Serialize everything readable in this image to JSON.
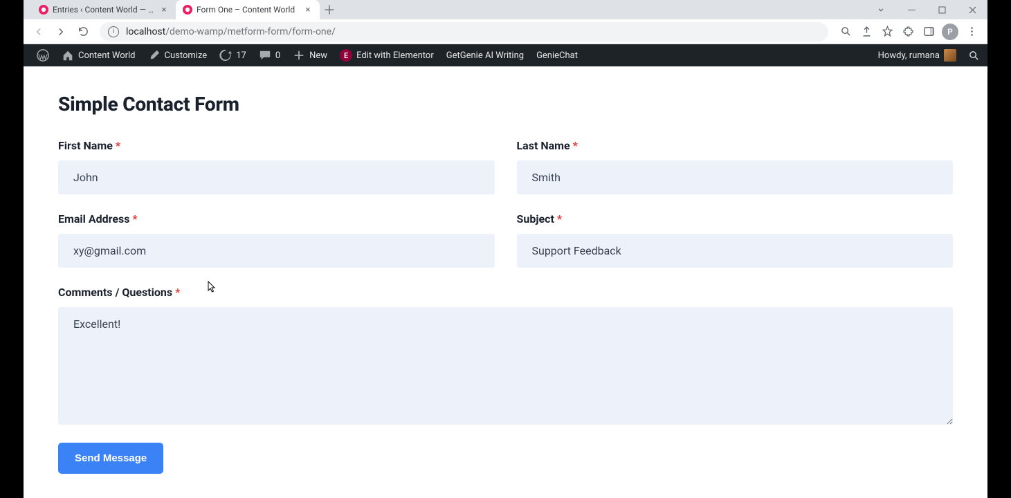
{
  "browser": {
    "tabs": [
      {
        "title": "Entries ‹ Content World — WordPress",
        "active": false
      },
      {
        "title": "Form One – Content World",
        "active": true
      }
    ],
    "url_host": "localhost",
    "url_path": "/demo-wamp/metform-form/form-one/",
    "profile_initial": "P"
  },
  "wp_bar": {
    "site_name": "Content World",
    "customize": "Customize",
    "updates_count": "17",
    "comments_count": "0",
    "new_label": "New",
    "edit_elementor": "Edit with Elementor",
    "getgenie": "GetGenie AI Writing",
    "geniechat": "GenieChat",
    "howdy": "Howdy, rumana"
  },
  "form": {
    "title": "Simple Contact Form",
    "fields": {
      "first_name": {
        "label": "First Name",
        "value": "John"
      },
      "last_name": {
        "label": "Last Name",
        "value": "Smith"
      },
      "email": {
        "label": "Email Address",
        "value": "xy@gmail.com"
      },
      "subject": {
        "label": "Subject",
        "value": "Support Feedback"
      },
      "comments": {
        "label": "Comments / Questions",
        "value": "Excellent!"
      }
    },
    "submit_label": "Send Message",
    "required_mark": "*"
  }
}
